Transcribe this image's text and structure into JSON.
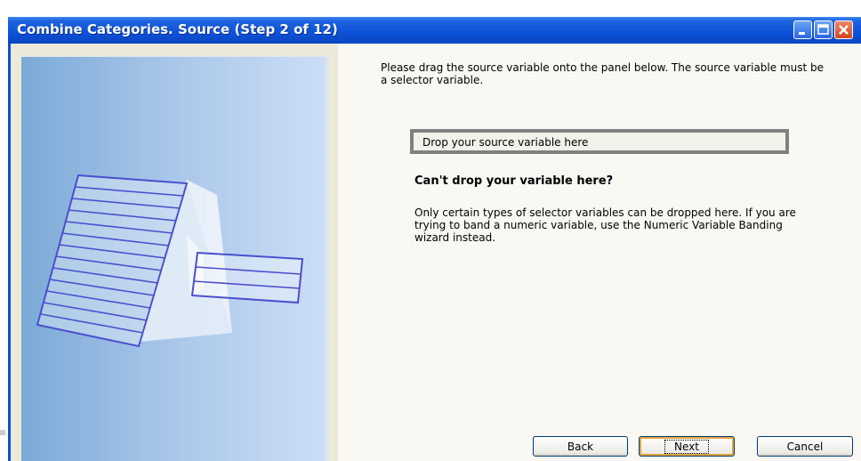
{
  "window": {
    "title": "Combine Categories.  Source (Step 2 of 12)"
  },
  "content": {
    "instruction": "Please drag the source variable onto the panel below. The source variable must be a selector variable.",
    "drop_zone": "Drop your source variable here",
    "warning_heading": "Can't drop your variable here?",
    "warning_text": "Only certain types of selector variables can be dropped here. If you are trying to band a numeric variable, use the Numeric Variable Banding wizard instead."
  },
  "buttons": {
    "back": "Back",
    "next": "Next",
    "cancel": "Cancel"
  },
  "icons": {
    "minimize": "minimize-icon",
    "maximize": "maximize-icon",
    "close": "close-icon"
  },
  "colors": {
    "titlebar": "#0c52d8",
    "close_button": "#d2451d",
    "dialog_background": "#ece9d8"
  }
}
